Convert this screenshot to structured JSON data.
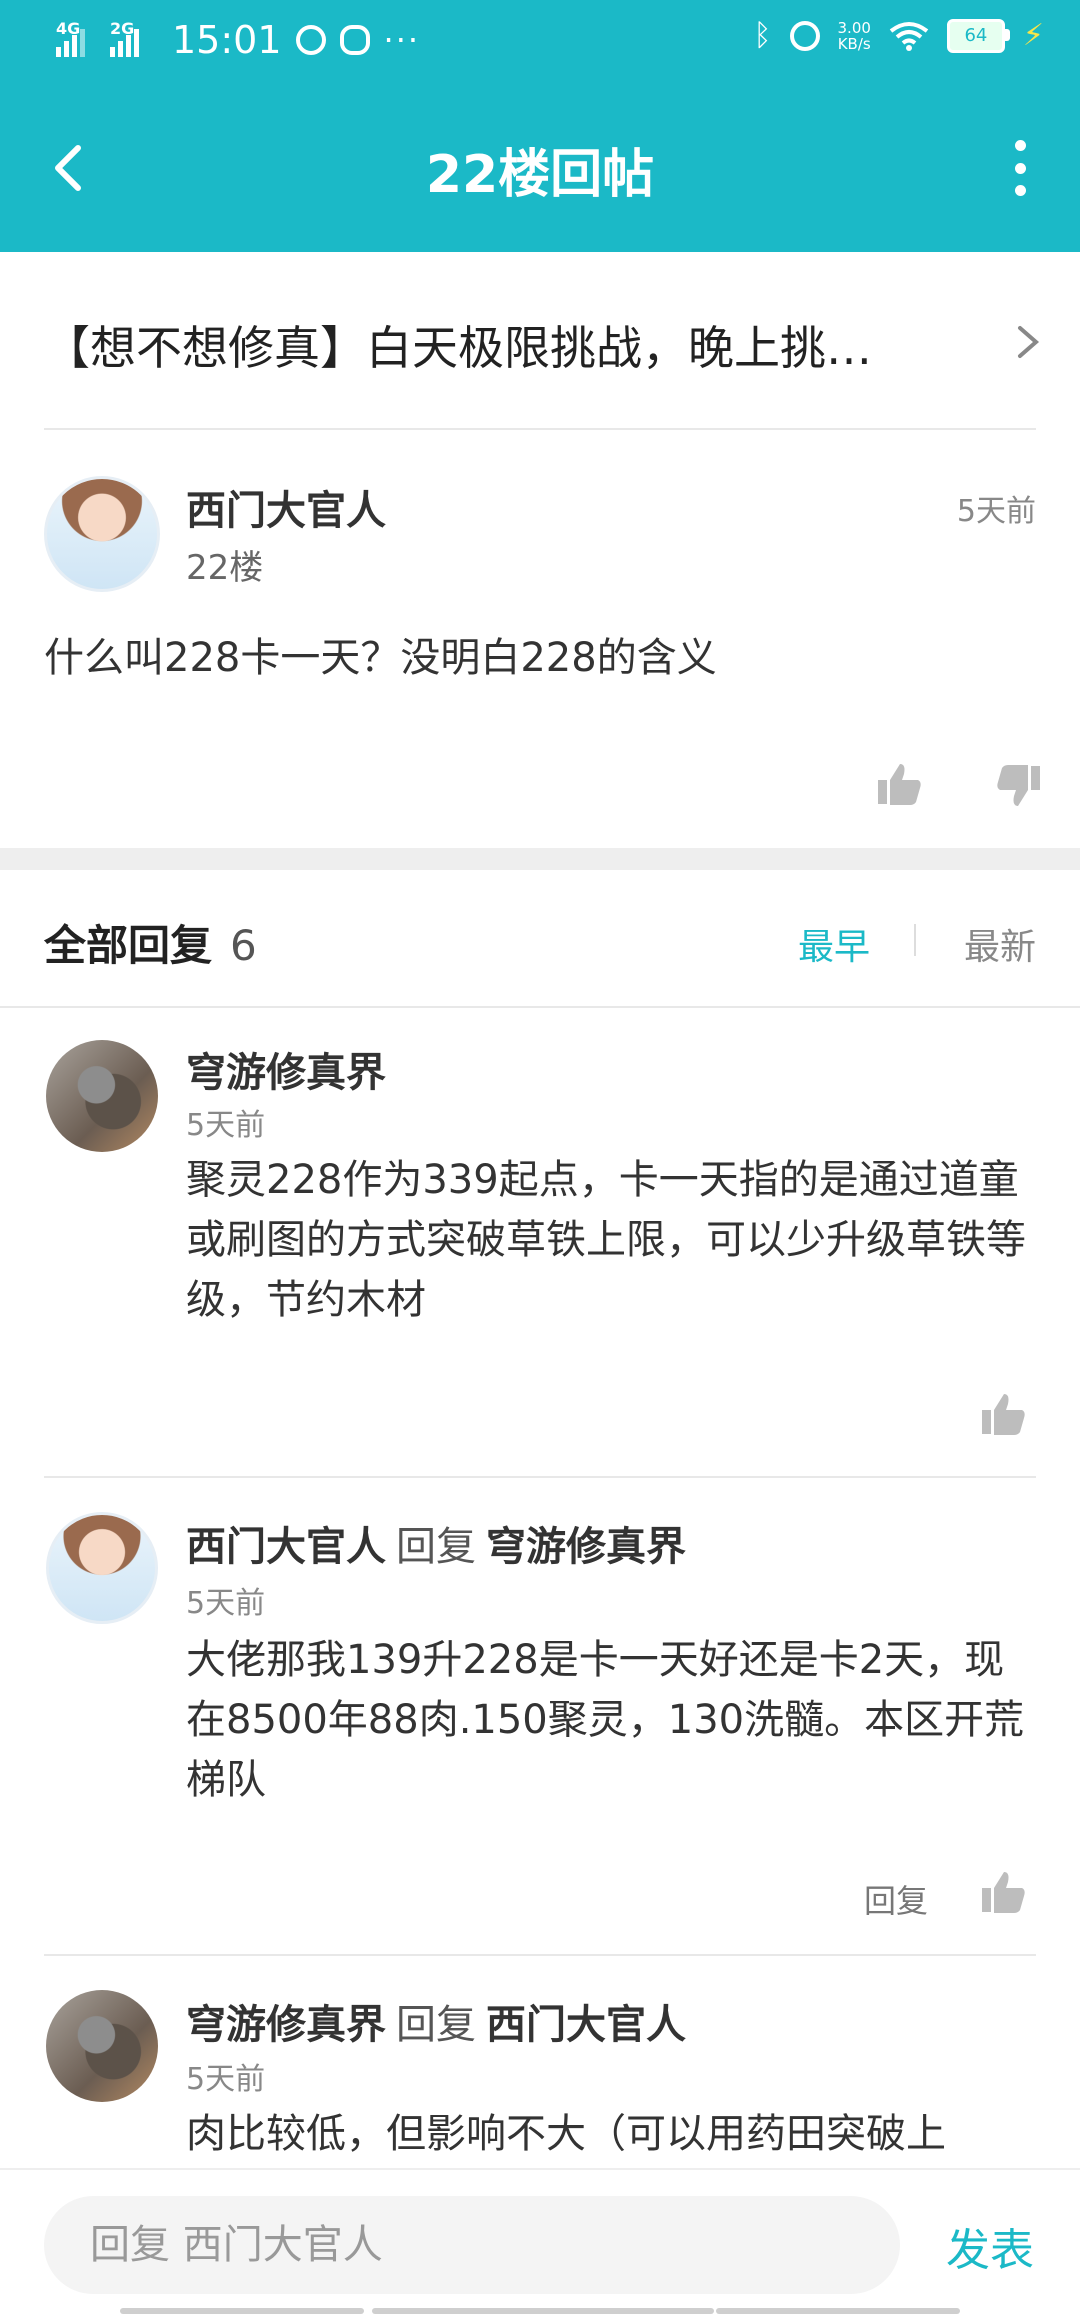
{
  "status": {
    "net1": "4G",
    "net2": "2G",
    "time": "15:01",
    "more": "···",
    "speed_value": "3.00",
    "speed_unit": "KB/s",
    "battery": "64"
  },
  "nav": {
    "title": "22楼回帖"
  },
  "thread": {
    "title": "【想不想修真】白天极限挑战，晚上挑…"
  },
  "post": {
    "author": "西门大官人",
    "floor": "22楼",
    "time": "5天前",
    "text": "什么叫228卡一天？没明白228的含义"
  },
  "replies_header": {
    "label": "全部回复",
    "count": "6",
    "sort_earliest": "最早",
    "sort_latest": "最新"
  },
  "replies": [
    {
      "author": "穹游修真界",
      "time": "5天前",
      "text": "聚灵228作为339起点，卡一天指的是通过道童或刷图的方式突破草铁上限，可以少升级草铁等级，节约木材"
    },
    {
      "author": "西门大官人",
      "reply_word": "回复",
      "reply_to": "穹游修真界",
      "time": "5天前",
      "text": "大佬那我139升228是卡一天好还是卡2天，现在8500年88肉.150聚灵，130洗髓。本区开荒梯队",
      "reply_label": "回复"
    },
    {
      "author": "穹游修真界",
      "reply_word": "回复",
      "reply_to": "西门大官人",
      "time": "5天前",
      "text": "肉比较低，但影响不大（可以用药田突破上"
    }
  ],
  "composer": {
    "placeholder": "回复 西门大官人",
    "send_label": "发表"
  },
  "colors": {
    "accent": "#1bb9c7",
    "icon_gray": "#bdbdbd"
  }
}
